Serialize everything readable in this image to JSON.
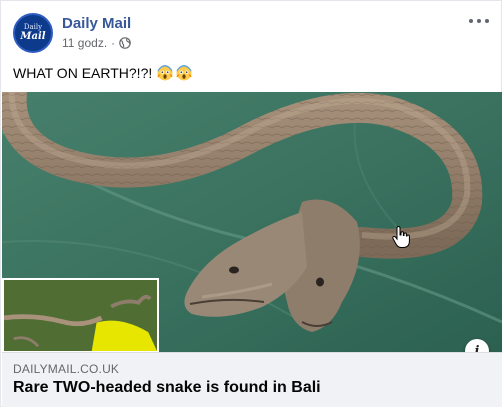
{
  "post": {
    "page_name": "Daily Mail",
    "avatar_text_top": "Daily",
    "avatar_text_bottom": "Mail",
    "time": "11 godz.",
    "separator": "·",
    "caption": "WHAT ON EARTH?!?!",
    "audience_icon": "globe-icon",
    "more_icon": "more-options-icon",
    "caption_emoji": [
      "screaming-face-emoji",
      "screaming-face-emoji"
    ]
  },
  "link_preview": {
    "domain": "DAILYMAIL.CO.UK",
    "headline": "Rare TWO-headed snake is found in Bali",
    "info_icon": "info-icon"
  },
  "colors": {
    "page_name": "#385898",
    "secondary_text": "#65676b",
    "link_bg": "#f0f2f5",
    "avatar_bg": "#0e3a8c"
  }
}
